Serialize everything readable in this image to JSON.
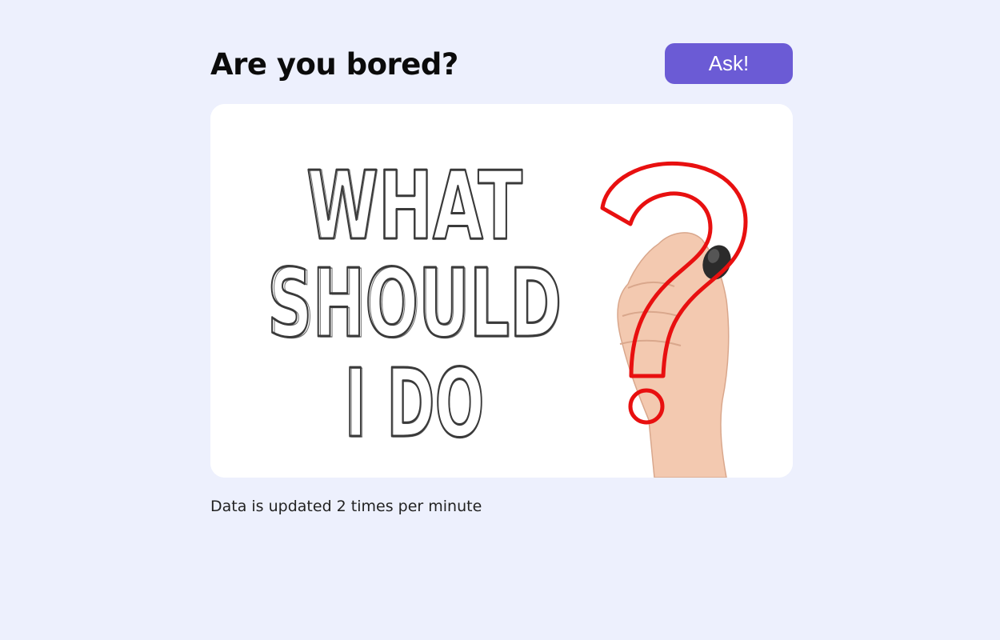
{
  "header": {
    "title": "Are you bored?",
    "ask_label": "Ask!"
  },
  "illustration": {
    "lines": [
      "WHAT",
      "SHOULD",
      "I DO"
    ],
    "mark": "?",
    "icon": "question-mark-icon"
  },
  "footer": {
    "update_note": "Data is updated 2 times per minute"
  },
  "colors": {
    "background": "#edf0fd",
    "accent": "#6b5bd5",
    "question_mark": "#e81010",
    "sketch_text": "#3a3a3a",
    "skin": "#f3c9b0"
  }
}
